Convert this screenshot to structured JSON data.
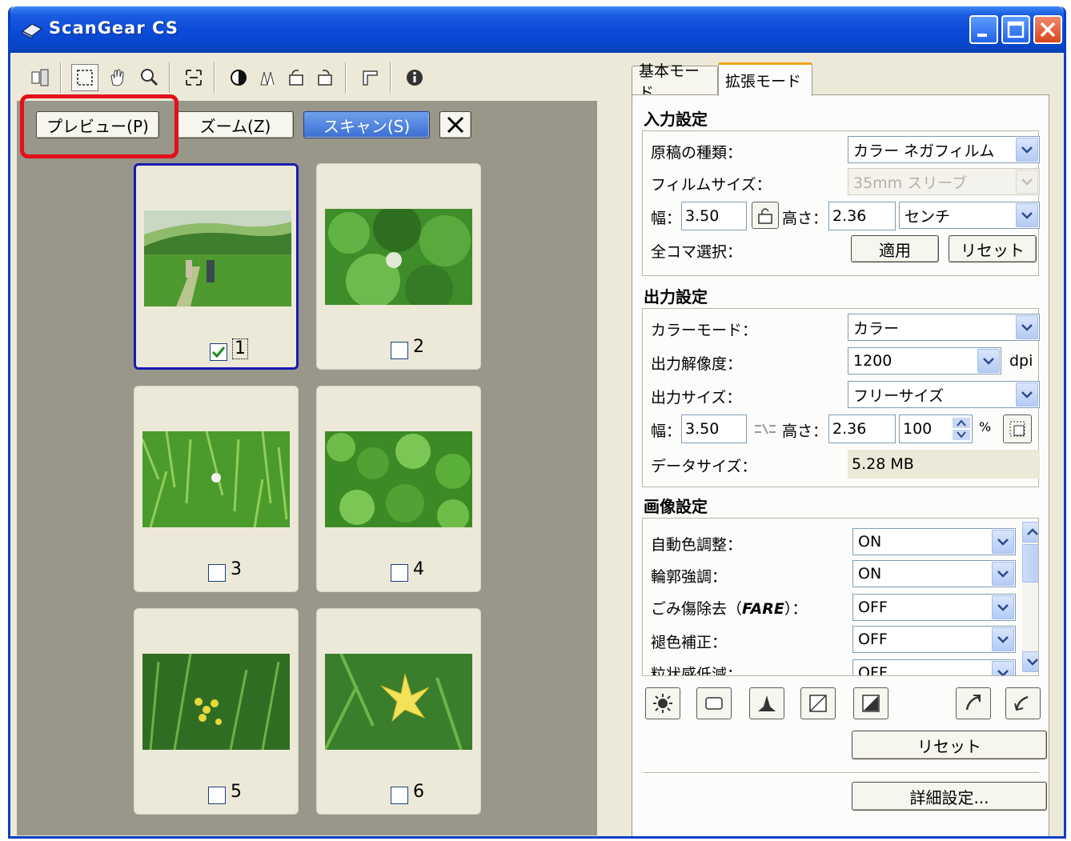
{
  "window": {
    "title": "ScanGear CS"
  },
  "preview": {
    "buttons": {
      "preview": "プレビュー(P)",
      "zoom": "ズーム(Z)",
      "scan": "スキャン(S)"
    },
    "frames": [
      {
        "number": "1",
        "checked": true
      },
      {
        "number": "2",
        "checked": false
      },
      {
        "number": "3",
        "checked": false
      },
      {
        "number": "4",
        "checked": false
      },
      {
        "number": "5",
        "checked": false
      },
      {
        "number": "6",
        "checked": false
      }
    ]
  },
  "tabs": {
    "basic": "基本モード",
    "advanced": "拡張モード"
  },
  "input_settings": {
    "title": "入力設定",
    "doc_type_label": "原稿の種類：",
    "doc_type_value": "カラー ネガフィルム",
    "film_size_label": "フィルムサイズ：",
    "film_size_value": "35mm スリーブ",
    "width_label": "幅：",
    "width_value": "3.50",
    "height_label": "高さ：",
    "height_value": "2.36",
    "unit_value": "センチ",
    "all_frames_label": "全コマ選択：",
    "apply_button": "適用",
    "reset_button": "リセット"
  },
  "output_settings": {
    "title": "出力設定",
    "color_mode_label": "カラーモード：",
    "color_mode_value": "カラー",
    "resolution_label": "出力解像度：",
    "resolution_value": "1200",
    "resolution_unit": "dpi",
    "output_size_label": "出力サイズ：",
    "output_size_value": "フリーサイズ",
    "width_label": "幅：",
    "width_value": "3.50",
    "height_label": "高さ：",
    "height_value": "2.36",
    "scale_value": "100",
    "scale_unit": "%",
    "data_size_label": "データサイズ：",
    "data_size_value": "5.28 MB"
  },
  "image_settings": {
    "title": "画像設定",
    "rows": [
      {
        "label": "自動色調整：",
        "value": "ON"
      },
      {
        "label": "輪郭強調：",
        "value": "ON"
      },
      {
        "label": "ごみ傷除去（",
        "label_brand": "FARE",
        "label_tail": "）：",
        "value": "OFF"
      },
      {
        "label": "褪色補正：",
        "value": "OFF"
      },
      {
        "label": "粒状感低減：",
        "value": "OFF"
      }
    ]
  },
  "bottom": {
    "reset_button": "リセット",
    "details_button": "詳細設定..."
  },
  "colors": {
    "titlebar": "#0a4ad8",
    "highlight": "#e3101c",
    "preview_bg": "#99968a",
    "active_frame": "#1a1ab4"
  }
}
